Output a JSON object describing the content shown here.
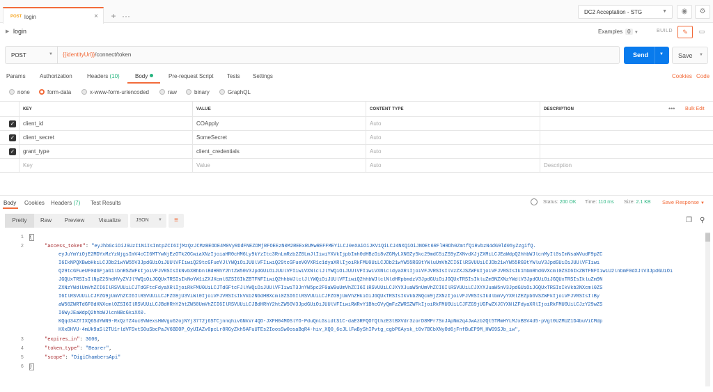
{
  "tab": {
    "method": "POST",
    "name": "login"
  },
  "environment": {
    "selected": "DC2 Acceptation - STG"
  },
  "request": {
    "title": "login",
    "examples_label": "Examples",
    "examples_count": "0",
    "build_label": "BUILD",
    "method": "POST",
    "url_var": "{{identityUrl}}",
    "url_path": "/connect/token",
    "send_label": "Send",
    "save_label": "Save"
  },
  "req_tabs": {
    "params": "Params",
    "authorization": "Authorization",
    "headers": "Headers",
    "headers_count": "(10)",
    "body": "Body",
    "prerequest": "Pre-request Script",
    "tests": "Tests",
    "settings": "Settings",
    "cookies": "Cookies",
    "code": "Code"
  },
  "body_types": [
    "none",
    "form-data",
    "x-www-form-urlencoded",
    "raw",
    "binary",
    "GraphQL"
  ],
  "table": {
    "headers": [
      "KEY",
      "VALUE",
      "CONTENT TYPE",
      "DESCRIPTION"
    ],
    "bulk_edit": "Bulk Edit",
    "rows": [
      {
        "key": "client_id",
        "value": "COApply",
        "ctype": "Auto"
      },
      {
        "key": "client_secret",
        "value": "SomeSecret",
        "ctype": "Auto"
      },
      {
        "key": "grant_type",
        "value": "client_credentials",
        "ctype": "Auto"
      }
    ],
    "placeholder": {
      "key": "Key",
      "value": "Value",
      "ctype": "Auto",
      "description": "Description"
    }
  },
  "response": {
    "tabs": {
      "body": "Body",
      "cookies": "Cookies",
      "headers": "Headers",
      "headers_count": "(7)",
      "tests": "Test Results"
    },
    "status_label": "Status:",
    "status_value": "200 OK",
    "time_label": "Time:",
    "time_value": "110 ms",
    "size_label": "Size:",
    "size_value": "2.1 KB",
    "save_response": "Save Response"
  },
  "view": {
    "pretty": "Pretty",
    "raw": "Raw",
    "preview": "Preview",
    "visualize": "Visualize",
    "format": "JSON"
  },
  "json": {
    "open": "{",
    "close": "}",
    "access_token_key": "\"access_token\"",
    "access_token_lines": [
      "\"eyJhbGciOiJSUzI1NiIsImtpZCI6IjMzQzJCMzBEODE4M0VyRDdFNEZDMjRFOEEzN0M2REExRUMwREFFMEYiLCJ0eXAiOiJKV1QiLCJ4NXQiOiJNOEt6RFlHRDh0ZmtfQ1RvbzN4dG9ld05yZzgifQ.",
      "eyJuYmYiOjE2MDYxMzYzNjgsImV4cCI6MTYwNjEzOTk2OCwiaXNzIjoiaHR0cHM6Ly9kYzItc3RnLmRzb2Z0LmJlIiwiYXVkIjpbImh0dHBzOi8vZGMyLXN0Zy5kc29mdC5iZS9yZXNvdXJjZXMiLCJEaWdpQ2hhbWJlcnMyIl0sImNsaWVudF9pZC",
      "I6IkNPQXBwbHkiLCJDb21wYW55V3JpdGUiOiJUUlVFIiwiQ29tcGFueVJlYWQiOiJUUlVFIiwiQ29tcGFueV0VXR1c1dyaXRlIjoiRkFMU0UiLCJDb21wYW55RG9tYWluUmVhZCI6IlRSVUUiLCJDb21wYW55RG9tYWluV3JpdGUiOiJUUlVFIiwi",
      "Q29tcGFueUF0dGFjaG1lbnRSZWFkIjoiVFJVRSIsIkNvbXBhbnlBdHRhY2htZW50V3JpdGUiOiJUUlVFIiwiVXNlclJlYWQiOiJUUlVFIiwiVXNlcldyaXRlIjoiVFJVRSIsIlVzZXJSZWFkIjoiVFJVRSIsIk1hbmRhdGVXcml0ZSI6IkZBTFNFIiwiU2lnbmF0dXJlV3JpdGUiOi",
      "JGQUxTRSIsIlNpZ25hdHVyZVJlYWQiOiJGQUxTRSIsIkNoYW1iZXJXcml0ZSI6IkZBTFNFIiwiQ2hhbWJlclJlYWQiOiJUUlVFIiwiQ2hhbWJlclNldHRpbmdzV3JpdGUiOiJGQUxTRSIsIkluZm9NZXNzYWdlV3JpdGUiOiJGQUxTRSIsIkluZm9N",
      "ZXNzYWdlUmVhZCI6IlRSVUUiLCJTdGFtcFdyaXRlIjoiRkFMU0UiLCJTdGFtcFJlYWQiOiJUUlVFIiwiT3JnYW5pc2F0aW9uUmVhZCI6IlRSVUUiLCJXYXJuaW5nUmVhZCI6IlRSVUUiLCJXYXJuaW5nV3JpdGUiOiJGQUxTRSIsIkVkb2NXcml0ZS",
      "I6IlRSVUUiLCJFZG9jUmVhZCI6IlRSVUUiLCJFZG9jU3ViWl0IjoiVFJVRSIsIkVkb2NGdHBXcml0ZSI6IlRSVUUiLCJFZG9jUmVhZHkiOiJGQUxTRSIsIkVkb2NQcm9jZXNzIjoiVFJVRSIsIkdlbmVyYXRlZEZpbGVSZWFkIjoiVFJVRSIsIlBy",
      "aW50ZWRTdGF0dXNXcml0ZSI6IlRSVUUiLCJBdHRhY2htZW50UmVhZCI6IlRSVUUiLCJBdHRhY2htZW50V3JpdGUiOiJUUlVFIiwiRWRvY1BhcGVyQmFzZWRSZWFkIjoiRkFMU0UiLCJFZG9jUGFwZXJCYXNlZFdyaXRlIjoiRkFMU0UiLCJzY29wZS",
      "I6WyJEaWdpQ2hhbWJlcnNBcGkiXX0.",
      "KQqd34ZfIXQ6SdYWN9-RxQzfZ4uc0VWexsHWVgu62ojNYj3772j6STCjnnqhivGNkVr4QD-JXFH04MOSlYO-PduQnLGsidtS1C-daE3RFQOfQthzE3tBXVdr3zorD8MPr7SnJApNm2q4JwAzb2Qt5TMmHYLMJxBSV4d5-pVgt0UZMUZ1D4buViCMdp",
      "HXxDHVU-4mUk9aSl2TU1rldVFSvtS0uSbcPaJV6BDOP_OyUIAZv0pcLr8RGyZkh5AFuUTEs2IoosSw0osaBqR4-hiv_XQ0_6cJLlFwByShIPvtg_cgbP6Aysk_t0v7BCbXNyOd6jFnfBuEP9M_HW09SJb_iw\","
    ],
    "expires_key": "\"expires_in\"",
    "expires_val": "3600",
    "token_type_key": "\"token_type\"",
    "token_type_val": "\"Bearer\"",
    "scope_key": "\"scope\"",
    "scope_val": "\"DigiChambersApi\"",
    "line_numbers": [
      "1",
      "2",
      "3",
      "4",
      "5",
      "6"
    ]
  }
}
